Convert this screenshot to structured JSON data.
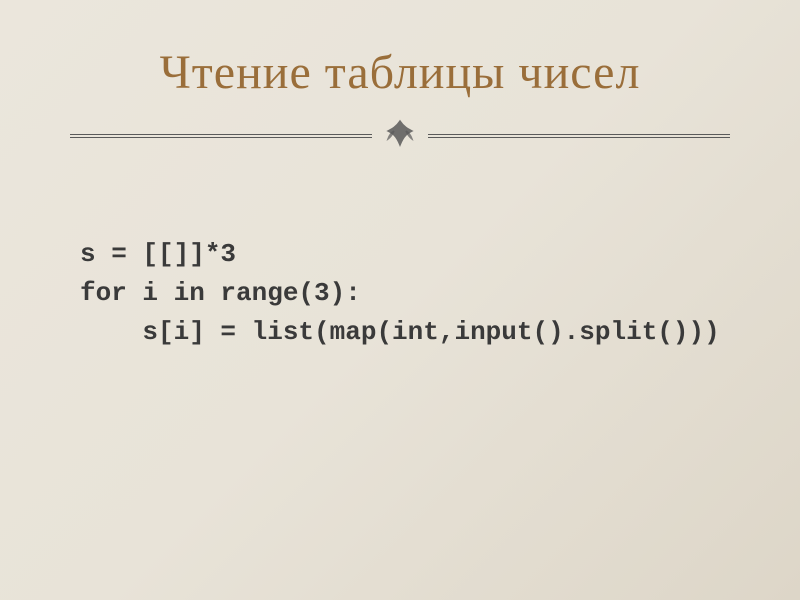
{
  "slide": {
    "title": "Чтение таблицы чисел",
    "code": {
      "line1": "s = [[]]*3",
      "line2": "for i in range(3):",
      "line3": "    s[i] = list(map(int,input().split()))"
    }
  }
}
